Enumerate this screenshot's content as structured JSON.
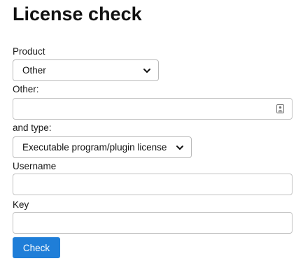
{
  "page": {
    "title": "License check"
  },
  "form": {
    "product": {
      "label": "Product",
      "selected": "Other"
    },
    "other": {
      "label": "Other:",
      "value": "",
      "icon": "contact-card-icon"
    },
    "type": {
      "label": "and type:",
      "selected": "Executable program/plugin license"
    },
    "username": {
      "label": "Username",
      "value": ""
    },
    "key": {
      "label": "Key",
      "value": ""
    },
    "submit_label": "Check"
  },
  "colors": {
    "button_bg": "#1f7ed8",
    "button_text": "#ffffff",
    "border": "#c2c2c2"
  }
}
